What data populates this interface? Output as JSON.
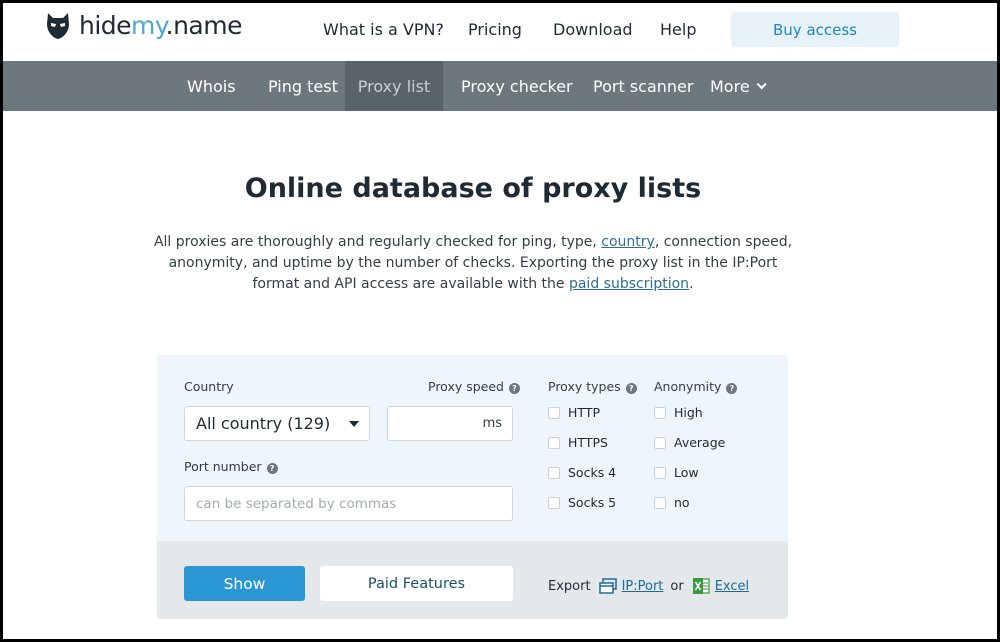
{
  "header": {
    "logo": {
      "main": "hide",
      "accent": "my",
      "suffix": ".name"
    },
    "nav": [
      "What is a VPN?",
      "Pricing",
      "Download",
      "Help"
    ],
    "buy_label": "Buy access"
  },
  "subnav": {
    "items": [
      "Whois",
      "Ping test",
      "Proxy list",
      "Proxy checker",
      "Port scanner",
      "More"
    ],
    "active": "Proxy list"
  },
  "hero": {
    "title": "Online database of proxy lists",
    "desc_1": "All proxies are thoroughly and regularly checked for ping, type, ",
    "desc_link_country": "country",
    "desc_2": ", connection speed, anonymity, and uptime by the number of checks. Exporting the proxy list in the IP:Port format and API access are available with the ",
    "desc_link_paid": "paid subscription",
    "desc_3": "."
  },
  "filters": {
    "country_label": "Country",
    "country_value": "All country (129)",
    "speed_label": "Proxy speed",
    "speed_unit": "ms",
    "port_label": "Port number",
    "port_placeholder": "can be separated by commas",
    "types_label": "Proxy types",
    "types": [
      "HTTP",
      "HTTPS",
      "Socks 4",
      "Socks 5"
    ],
    "anonymity_label": "Anonymity",
    "anonymity": [
      "High",
      "Average",
      "Low",
      "no"
    ]
  },
  "actions": {
    "show_label": "Show",
    "paid_label": "Paid Features",
    "export_label": "Export",
    "export_ipport": "IP:Port",
    "export_or": "or",
    "export_excel": "Excel"
  },
  "colors": {
    "subnav_bg": "#6c787e",
    "primary": "#2a97d4",
    "panel_bg": "#eef6fb"
  }
}
